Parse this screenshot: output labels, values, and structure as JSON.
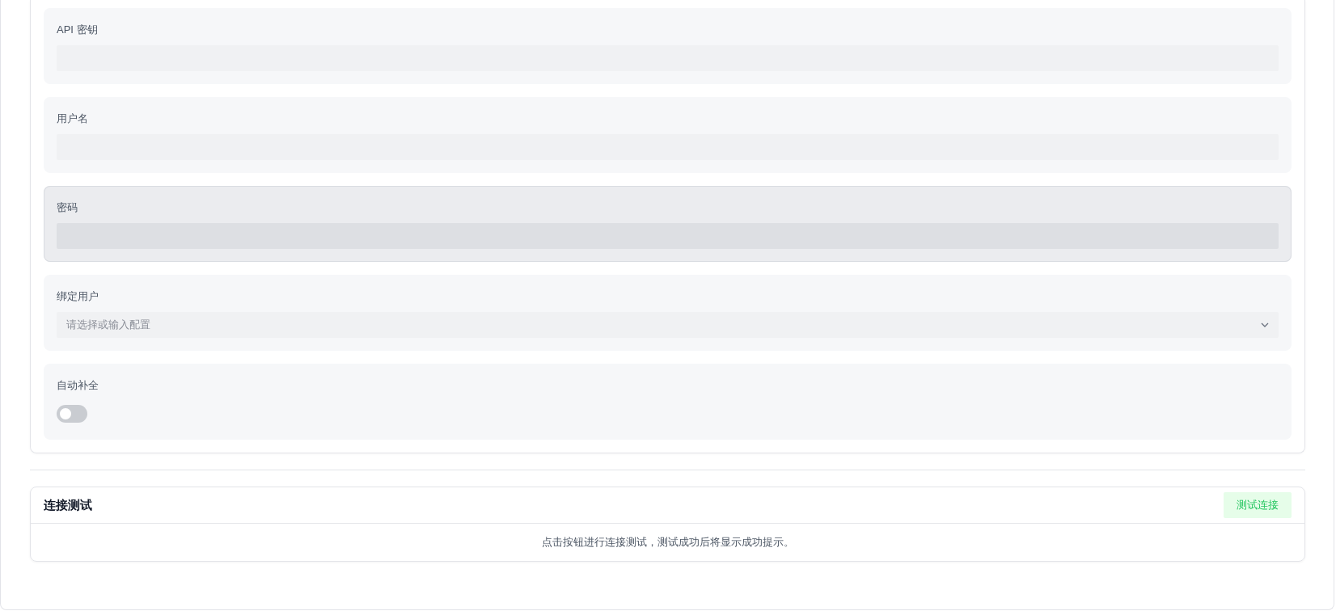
{
  "fields": [
    {
      "kind": "text",
      "label": "API 密钥",
      "hovered": false
    },
    {
      "kind": "text",
      "label": "用户名",
      "hovered": false
    },
    {
      "kind": "password",
      "label": "密码",
      "hovered": true
    },
    {
      "kind": "select",
      "label": "绑定用户",
      "placeholder": "请选择或输入配置",
      "hovered": false
    },
    {
      "kind": "switch",
      "label": "自动补全",
      "on": false,
      "hovered": false
    }
  ],
  "connection_test": {
    "title": "连接测试",
    "button": "测试连接",
    "hint": "点击按钮进行连接测试，测试成功后将显示成功提示。"
  }
}
